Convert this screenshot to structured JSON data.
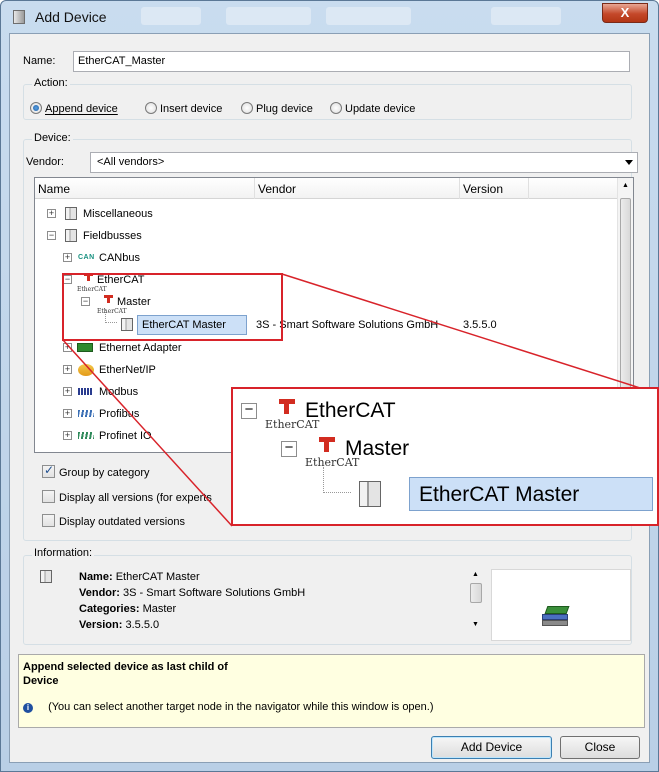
{
  "window": {
    "title": "Add Device",
    "close_glyph": "X"
  },
  "name_field": {
    "label": "Name:",
    "value": "EtherCAT_Master"
  },
  "action": {
    "label": "Action:",
    "options": [
      "Append device",
      "Insert device",
      "Plug device",
      "Update device"
    ],
    "selected": "Append device"
  },
  "device": {
    "label": "Device:",
    "vendor_label": "Vendor:",
    "vendor_value": "<All vendors>"
  },
  "tree": {
    "columns": [
      "Name",
      "Vendor",
      "Version"
    ],
    "rows": [
      {
        "label": "Miscellaneous",
        "expander": "+",
        "icon": "device-icon"
      },
      {
        "label": "Fieldbusses",
        "expander": "−",
        "icon": "device-icon"
      },
      {
        "label": "CANbus",
        "expander": "+",
        "icon": "can-icon",
        "icon_text": "CAN"
      },
      {
        "label": "EtherCAT",
        "expander": "−",
        "icon": "ethercat-icon"
      },
      {
        "label": "Master",
        "expander": "−",
        "icon": "ethercat-icon"
      },
      {
        "label": "EtherCAT Master",
        "vendor": "3S - Smart Software Solutions GmbH",
        "version": "3.5.5.0",
        "icon": "device-icon",
        "selected": true
      },
      {
        "label": "Ethernet Adapter",
        "expander": "+",
        "icon": "network-card-icon"
      },
      {
        "label": "EtherNet/IP",
        "expander": "+",
        "icon": "ethernet-ip-icon"
      },
      {
        "label": "Modbus",
        "expander": "+",
        "icon": "modbus-icon"
      },
      {
        "label": "Profibus",
        "expander": "+",
        "icon": "profibus-icon"
      },
      {
        "label": "Profinet IO",
        "expander": "+",
        "icon": "profinet-icon"
      }
    ],
    "icon_caption": "EtherCAT"
  },
  "options": {
    "group_by_category": {
      "label": "Group by category",
      "checked": true
    },
    "display_all_versions": {
      "label": "Display all versions (for experts",
      "checked": false
    },
    "display_outdated": {
      "label": "Display outdated versions",
      "checked": false
    }
  },
  "information": {
    "label": "Information:",
    "name_key": "Name:",
    "name_value": "EtherCAT Master",
    "vendor_key": "Vendor:",
    "vendor_value": "3S - Smart Software Solutions GmbH",
    "categories_key": "Categories:",
    "categories_value": "Master",
    "version_key": "Version:",
    "version_value": "3.5.5.0"
  },
  "hint": {
    "title_line1": "Append selected device as last child of",
    "title_line2": "Device",
    "note": "(You can select another target node in the navigator while this window is open.)"
  },
  "buttons": {
    "add_device": "Add Device",
    "close": "Close"
  },
  "callout": {
    "row1": "EtherCAT",
    "row2": "Master",
    "row3": "EtherCAT Master"
  },
  "colors": {
    "highlight": "#d8232a",
    "selection": "#cce0f7",
    "hint_bg": "#ffffe1"
  }
}
